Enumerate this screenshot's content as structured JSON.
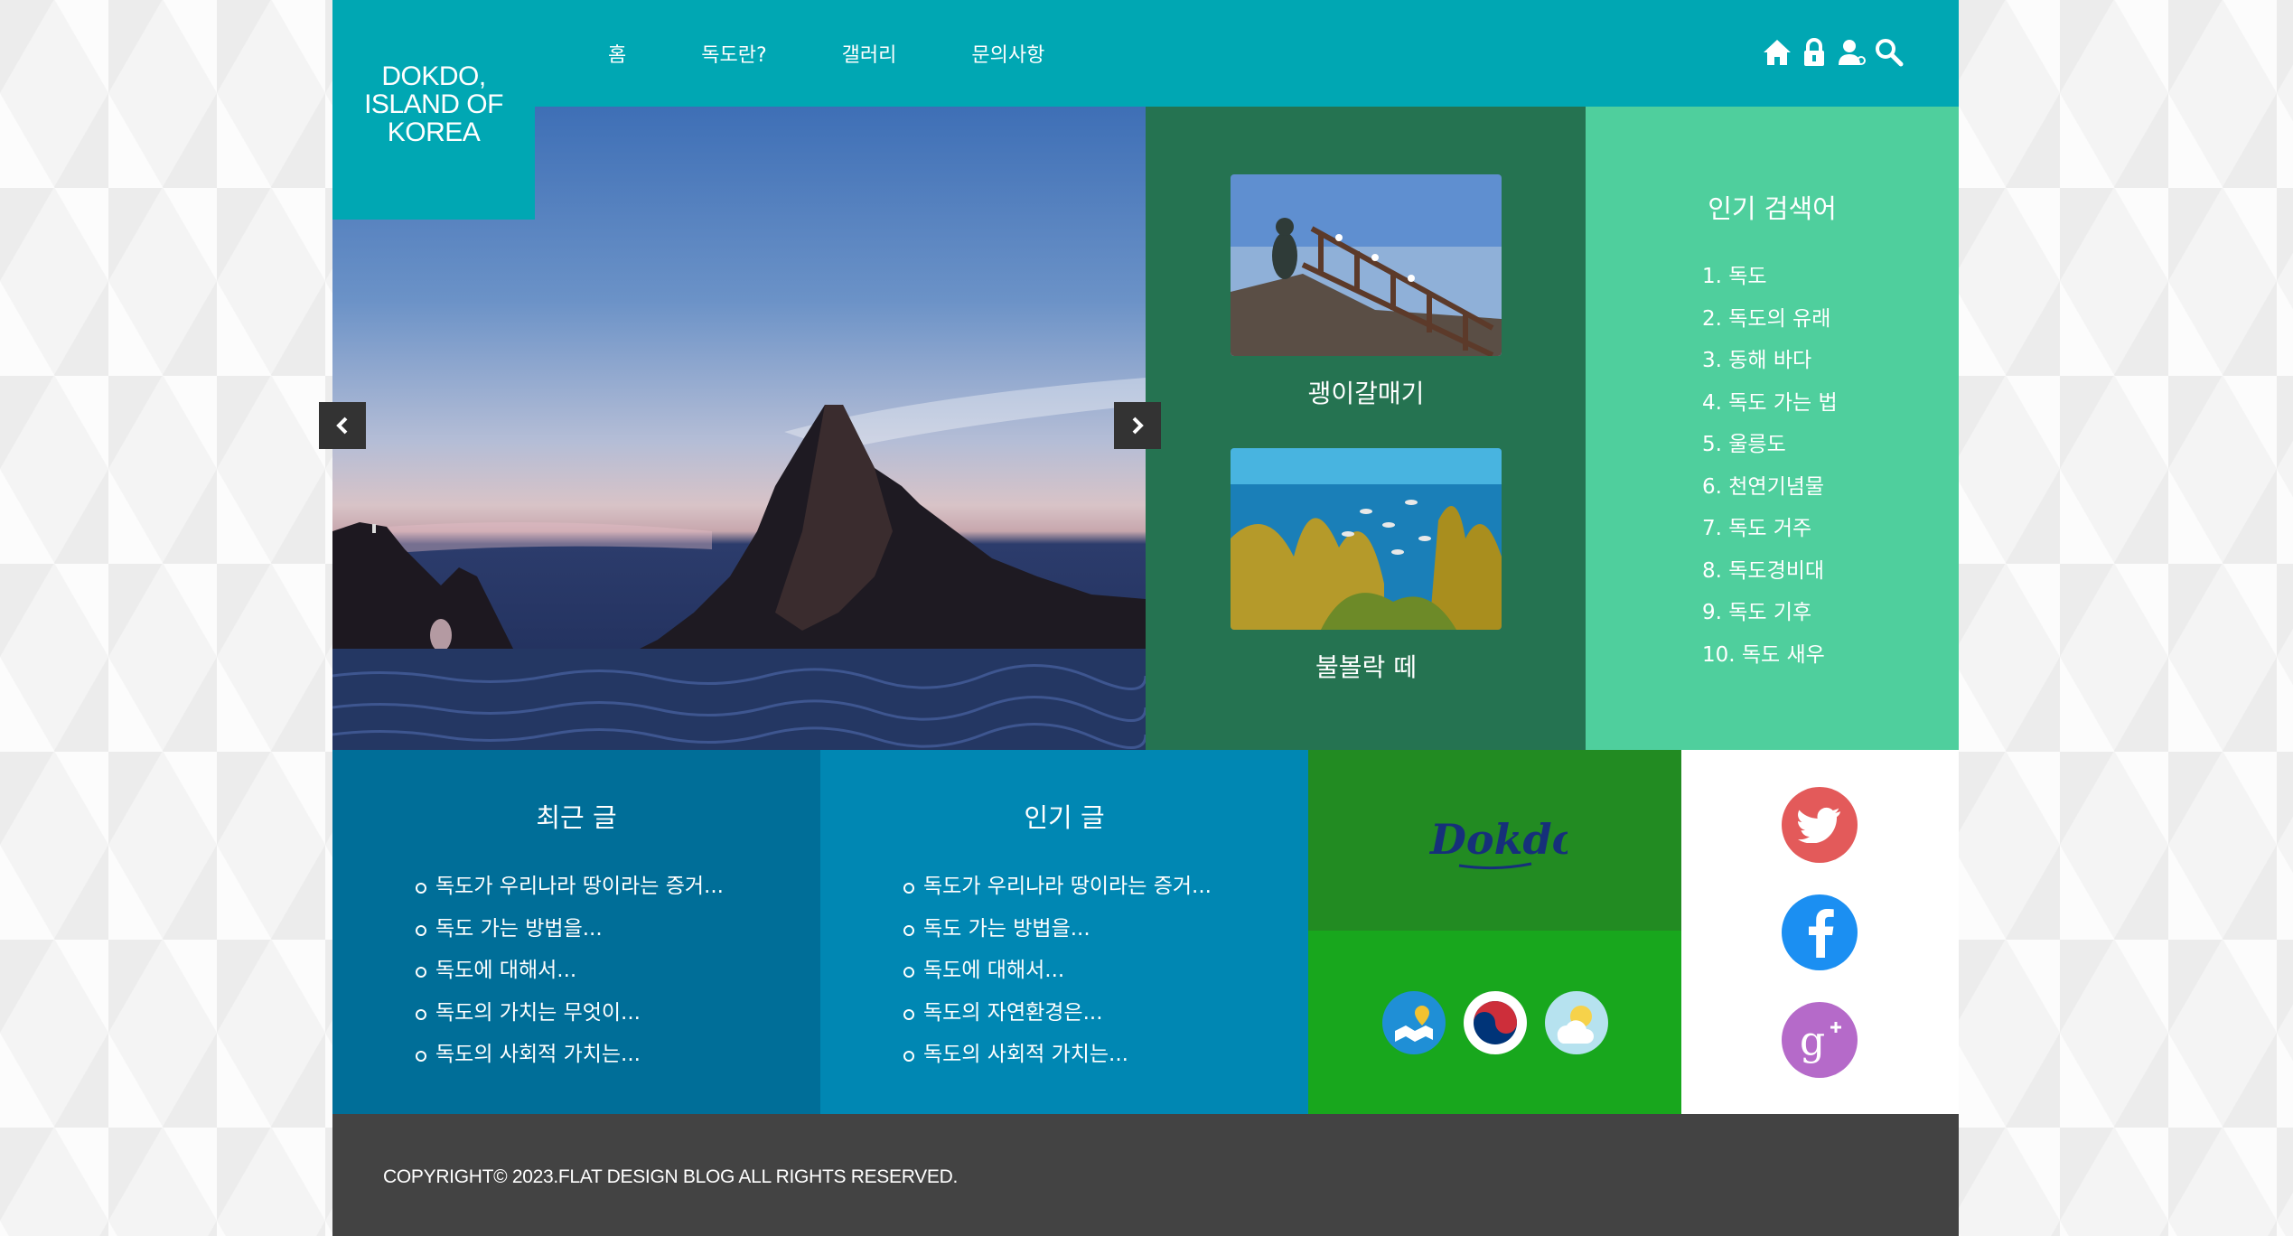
{
  "logo": {
    "text": "DOKDO,\nISLAND OF\nKOREA"
  },
  "nav": {
    "items": [
      {
        "label": "홈"
      },
      {
        "label": "독도란?"
      },
      {
        "label": "갤러리"
      },
      {
        "label": "문의사항"
      }
    ]
  },
  "utility_icons": [
    "home-icon",
    "lock-icon",
    "user-icon",
    "search-icon"
  ],
  "slider": {
    "prev_icon": "chevron-left-icon",
    "next_icon": "chevron-right-icon"
  },
  "featured": [
    {
      "caption": "괭이갈매기"
    },
    {
      "caption": "불볼락 떼"
    }
  ],
  "popular_search": {
    "title": "인기 검색어",
    "items": [
      "1. 독도",
      "2. 독도의 유래",
      "3. 동해 바다",
      "4. 독도 가는 법",
      "5. 울릉도",
      "6. 천연기념물",
      "7. 독도 거주",
      "8. 독도경비대",
      "9. 독도 기후",
      "10. 독도 새우"
    ]
  },
  "recent_posts": {
    "title": "최근 글",
    "items": [
      "독도가 우리나라 땅이라는 증거...",
      "독도 가는 방법을...",
      "독도에 대해서...",
      "독도의 가치는 무엇이...",
      "독도의 사회적 가치는..."
    ]
  },
  "popular_posts": {
    "title": "인기 글",
    "items": [
      "독도가 우리나라 땅이라는 증거...",
      "독도 가는 방법을...",
      "독도에 대해서...",
      "독도의 자연환경은...",
      "독도의 사회적 가치는..."
    ]
  },
  "brand": {
    "logo_text": "Dokdo,"
  },
  "services": [
    "map-icon",
    "taegeuk-icon",
    "weather-icon"
  ],
  "social": [
    "twitter-icon",
    "facebook-icon",
    "google-plus-icon"
  ],
  "colors": {
    "header": "#00a7b3",
    "featured": "#257351",
    "popular_search": "#4fcf9d",
    "recent": "#006e98",
    "popular_posts": "#0087b3",
    "brand": "#228b22",
    "services": "#18a71d",
    "footer": "#434343"
  },
  "footer": {
    "copyright": "COPYRIGHT© 2023.FLAT DESIGN BLOG ALL RIGHTS RESERVED."
  }
}
